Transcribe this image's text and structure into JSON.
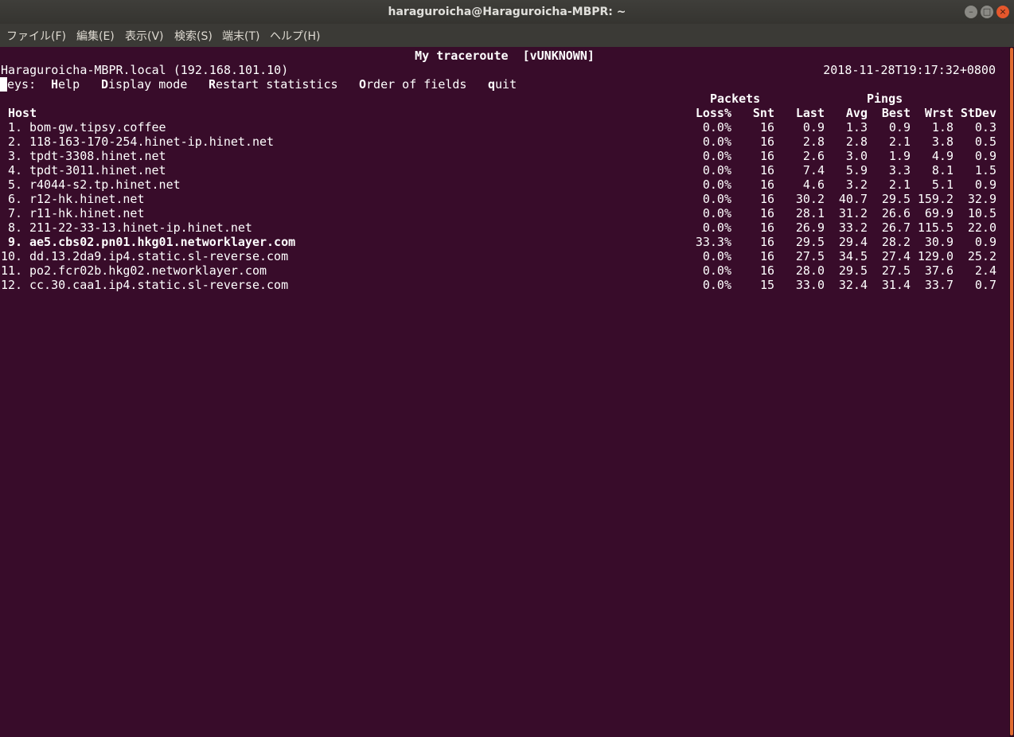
{
  "window": {
    "title": "haraguroicha@Haraguroicha-MBPR: ~",
    "buttons": {
      "minimize": "–",
      "maximize": "□",
      "close": "×"
    }
  },
  "menu": [
    "ファイル(F)",
    "編集(E)",
    "表示(V)",
    "検索(S)",
    "端末(T)",
    "ヘルプ(H)"
  ],
  "mtr": {
    "header": "My traceroute  [vUNKNOWN]",
    "host_info": "Haraguroicha-MBPR.local (192.168.101.10)",
    "timestamp": "2018-11-28T19:17:32+0800",
    "keys": {
      "label_rest": "eys:",
      "help_key": "H",
      "help_rest": "elp",
      "display_key": "D",
      "display_rest": "isplay mode",
      "restart_key": "R",
      "restart_rest": "estart statistics",
      "order_key": "O",
      "order_rest": "rder of fields",
      "quit_key": "q",
      "quit_rest": "uit"
    },
    "group_headers": {
      "packets": "Packets",
      "pings": "Pings"
    },
    "columns": {
      "host": "Host",
      "loss": "Loss%",
      "snt": "Snt",
      "last": "Last",
      "avg": "Avg",
      "best": "Best",
      "wrst": "Wrst",
      "stdev": "StDev"
    },
    "rows": [
      {
        "num": "1.",
        "host": "bom-gw.tipsy.coffee",
        "loss": "0.0%",
        "snt": "16",
        "last": "0.9",
        "avg": "1.3",
        "best": "0.9",
        "wrst": "1.8",
        "stdev": "0.3",
        "bold": false
      },
      {
        "num": "2.",
        "host": "118-163-170-254.hinet-ip.hinet.net",
        "loss": "0.0%",
        "snt": "16",
        "last": "2.8",
        "avg": "2.8",
        "best": "2.1",
        "wrst": "3.8",
        "stdev": "0.5",
        "bold": false
      },
      {
        "num": "3.",
        "host": "tpdt-3308.hinet.net",
        "loss": "0.0%",
        "snt": "16",
        "last": "2.6",
        "avg": "3.0",
        "best": "1.9",
        "wrst": "4.9",
        "stdev": "0.9",
        "bold": false
      },
      {
        "num": "4.",
        "host": "tpdt-3011.hinet.net",
        "loss": "0.0%",
        "snt": "16",
        "last": "7.4",
        "avg": "5.9",
        "best": "3.3",
        "wrst": "8.1",
        "stdev": "1.5",
        "bold": false
      },
      {
        "num": "5.",
        "host": "r4044-s2.tp.hinet.net",
        "loss": "0.0%",
        "snt": "16",
        "last": "4.6",
        "avg": "3.2",
        "best": "2.1",
        "wrst": "5.1",
        "stdev": "0.9",
        "bold": false
      },
      {
        "num": "6.",
        "host": "r12-hk.hinet.net",
        "loss": "0.0%",
        "snt": "16",
        "last": "30.2",
        "avg": "40.7",
        "best": "29.5",
        "wrst": "159.2",
        "stdev": "32.9",
        "bold": false
      },
      {
        "num": "7.",
        "host": "r11-hk.hinet.net",
        "loss": "0.0%",
        "snt": "16",
        "last": "28.1",
        "avg": "31.2",
        "best": "26.6",
        "wrst": "69.9",
        "stdev": "10.5",
        "bold": false
      },
      {
        "num": "8.",
        "host": "211-22-33-13.hinet-ip.hinet.net",
        "loss": "0.0%",
        "snt": "16",
        "last": "26.9",
        "avg": "33.2",
        "best": "26.7",
        "wrst": "115.5",
        "stdev": "22.0",
        "bold": false
      },
      {
        "num": "9.",
        "host": "ae5.cbs02.pn01.hkg01.networklayer.com",
        "loss": "33.3%",
        "snt": "16",
        "last": "29.5",
        "avg": "29.4",
        "best": "28.2",
        "wrst": "30.9",
        "stdev": "0.9",
        "bold": true
      },
      {
        "num": "10.",
        "host": "dd.13.2da9.ip4.static.sl-reverse.com",
        "loss": "0.0%",
        "snt": "16",
        "last": "27.5",
        "avg": "34.5",
        "best": "27.4",
        "wrst": "129.0",
        "stdev": "25.2",
        "bold": false
      },
      {
        "num": "11.",
        "host": "po2.fcr02b.hkg02.networklayer.com",
        "loss": "0.0%",
        "snt": "16",
        "last": "28.0",
        "avg": "29.5",
        "best": "27.5",
        "wrst": "37.6",
        "stdev": "2.4",
        "bold": false
      },
      {
        "num": "12.",
        "host": "cc.30.caa1.ip4.static.sl-reverse.com",
        "loss": "0.0%",
        "snt": "15",
        "last": "33.0",
        "avg": "32.4",
        "best": "31.4",
        "wrst": "33.7",
        "stdev": "0.7",
        "bold": false
      }
    ]
  }
}
